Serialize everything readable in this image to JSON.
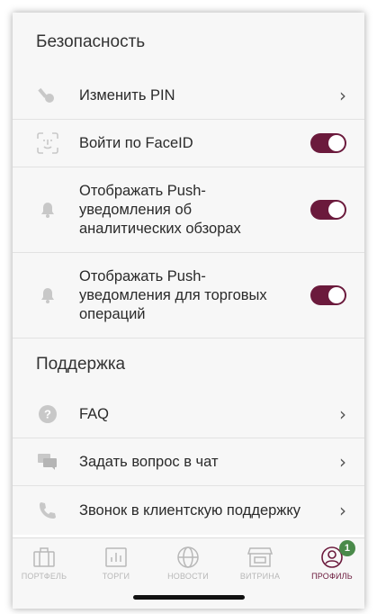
{
  "security": {
    "title": "Безопасность",
    "items": [
      {
        "label": "Изменить PIN",
        "icon": "key-icon",
        "control": "chevron"
      },
      {
        "label": "Войти по FaceID",
        "icon": "faceid-icon",
        "control": "toggle",
        "on": true
      },
      {
        "label": "Отображать Push-уведомления об аналитических обзорах",
        "icon": "bell-icon",
        "control": "toggle",
        "on": true
      },
      {
        "label": "Отображать Push-уведомления для торговых операций",
        "icon": "bell-icon",
        "control": "toggle",
        "on": true
      }
    ]
  },
  "support": {
    "title": "Поддержка",
    "items": [
      {
        "label": "FAQ",
        "icon": "question-icon",
        "control": "chevron"
      },
      {
        "label": "Задать вопрос в чат",
        "icon": "chat-icon",
        "control": "chevron"
      },
      {
        "label": "Звонок в клиентскую поддержку",
        "icon": "phone-icon",
        "control": "chevron"
      }
    ]
  },
  "tabbar": {
    "tabs": [
      {
        "label": "ПОРТФЕЛЬ",
        "icon": "briefcase-icon"
      },
      {
        "label": "ТОРГИ",
        "icon": "bar-chart-icon"
      },
      {
        "label": "НОВОСТИ",
        "icon": "globe-icon"
      },
      {
        "label": "ВИТРИНА",
        "icon": "storefront-icon"
      },
      {
        "label": "ПРОФИЛЬ",
        "icon": "profile-icon",
        "active": true,
        "badge": "1"
      }
    ]
  },
  "colors": {
    "accent": "#6b1a3c",
    "background": "#f7f7f7",
    "badge": "#4a8a4a",
    "inactive": "#b8b8b8"
  }
}
